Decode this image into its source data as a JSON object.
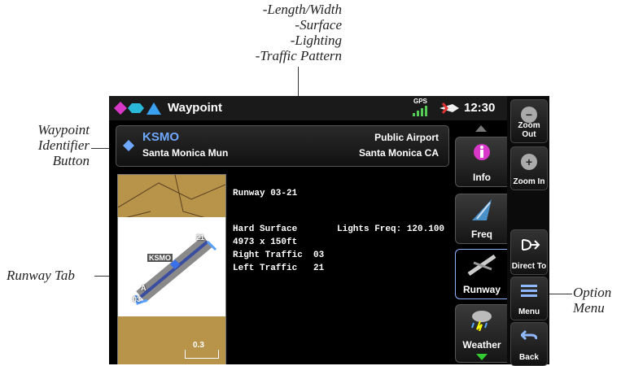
{
  "callouts": {
    "top": [
      "-Length/Width",
      "-Surface",
      "-Lighting",
      "-Traffic Pattern"
    ],
    "waypoint_id": [
      "Waypoint",
      "Identifier",
      "Button"
    ],
    "runway_tab": "Runway Tab",
    "option_menu": [
      "Option",
      "Menu"
    ]
  },
  "screen": {
    "title": "Waypoint",
    "clock": "12:30",
    "gps_label": "GPS",
    "waypoint": {
      "ident": "KSMO",
      "name": "Santa Monica Mun",
      "type": "Public Airport",
      "city": "Santa Monica CA"
    },
    "runway": {
      "id": "Runway 03-21",
      "surface": "Hard Surface",
      "size": "4973 x 150ft",
      "right_traffic": "Right Traffic  03",
      "left_traffic": "Left Traffic   21",
      "lights": "Lights Freq: 120.100"
    },
    "map": {
      "ident": "KSMO",
      "scale": "0.3",
      "rwy_end_a": "21",
      "rwy_end_b": "03",
      "marker_a": "A"
    },
    "tabs": [
      "Info",
      "Freq",
      "Runway",
      "Weather"
    ]
  },
  "side_buttons": [
    "Zoom Out",
    "Zoom In",
    "Direct To",
    "Menu",
    "Back"
  ],
  "colors": {
    "accent": "#8fb0ff",
    "ident": "#6fa8ff",
    "map_tan": "#b8934a"
  }
}
